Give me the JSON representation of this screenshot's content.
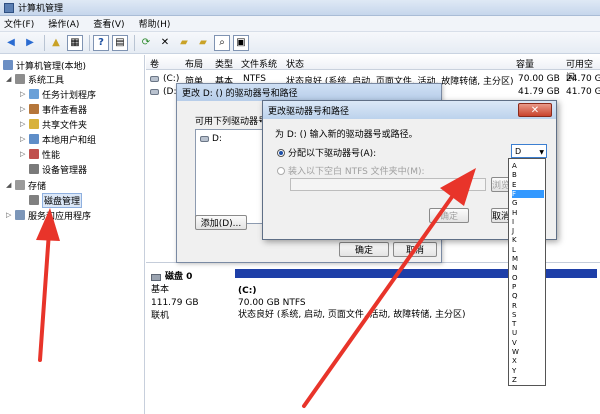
{
  "window": {
    "title": "计算机管理"
  },
  "menu": [
    "文件(F)",
    "操作(A)",
    "查看(V)",
    "帮助(H)"
  ],
  "tree": {
    "root": "计算机管理(本地)",
    "system_tools": "系统工具",
    "task_scheduler": "任务计划程序",
    "event_viewer": "事件查看器",
    "shared_folders": "共享文件夹",
    "local_users": "本地用户和组",
    "performance": "性能",
    "device_manager": "设备管理器",
    "storage": "存储",
    "disk_management": "磁盘管理",
    "services_apps": "服务和应用程序"
  },
  "grid": {
    "headers": [
      "卷",
      "布局",
      "类型",
      "文件系统",
      "状态",
      "容量",
      "可用空间"
    ],
    "row1": {
      "vol": "(C:)",
      "layout": "简单",
      "type": "基本",
      "fs": "NTFS",
      "status": "状态良好 (系统, 启动, 页面文件, 活动, 故障转储, 主分区)",
      "capacity": "70.00 GB",
      "free": "24.70 G"
    },
    "row2": {
      "vol": "(D:",
      "capacity": "41.79 GB",
      "free": "41.70 G"
    }
  },
  "disk": {
    "name": "磁盘 0",
    "type": "基本",
    "size": "111.79 GB",
    "state": "联机",
    "partition_name": "(C:)",
    "partition_size": "70.00 GB NTFS",
    "partition_status": "状态良好 (系统, 启动, 页面文件, 活动, 故障转储, 主分区)"
  },
  "dialog1": {
    "title": "更改 D: () 的驱动器号和路径",
    "label": "可用下列驱动器号和路径",
    "item": "D:",
    "add": "添加(D)...",
    "ok": "确定",
    "cancel": "取消"
  },
  "dialog2": {
    "title": "更改驱动器号和路径",
    "prompt": "为 D: () 输入新的驱动器号或路径。",
    "opt_assign": "分配以下驱动器号(A):",
    "opt_mount": "装入以下空白 NTFS 文件夹中(M):",
    "selected_letter": "D",
    "browse": "浏览",
    "ok": "确定",
    "cancel": "取消"
  },
  "letters": [
    "A",
    "B",
    "E",
    "F",
    "G",
    "H",
    "I",
    "J",
    "K",
    "L",
    "M",
    "N",
    "O",
    "P",
    "Q",
    "R",
    "S",
    "T",
    "U",
    "V",
    "W",
    "X",
    "Y",
    "Z"
  ],
  "selected_letter_index": 3,
  "colors": {
    "arrow": "#e8342a",
    "selection": "#3399ff",
    "disk_bar": "#1e3fa8"
  }
}
